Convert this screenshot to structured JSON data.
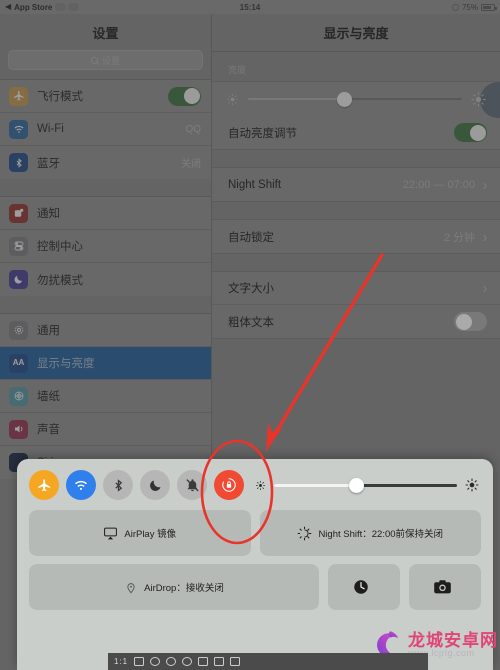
{
  "statusbar": {
    "back_icon": "back-arrow-icon",
    "app_name": "App Store",
    "time": "15:14",
    "battery_percent": "75%"
  },
  "sidebar": {
    "title": "设置",
    "search": {
      "placeholder": "设置",
      "icon": "search-icon"
    },
    "groups": [
      {
        "items": [
          {
            "label": "飞行模式",
            "icon": "airplane-icon",
            "color": "#f5a623",
            "control": "toggle",
            "on": true
          },
          {
            "label": "Wi-Fi",
            "icon": "wifi-icon",
            "color": "#1b7fe0",
            "control": "value",
            "value": "QQ"
          },
          {
            "label": "蓝牙",
            "icon": "bluetooth-icon",
            "color": "#1b5fd0",
            "control": "value",
            "value": "关闭"
          }
        ]
      },
      {
        "items": [
          {
            "label": "通知",
            "icon": "notification-icon",
            "color": "#e0342b",
            "control": "none"
          },
          {
            "label": "控制中心",
            "icon": "control-center-icon",
            "color": "#8e8e93",
            "control": "none"
          },
          {
            "label": "勿扰模式",
            "icon": "moon-icon",
            "color": "#5b4ce0",
            "control": "none"
          }
        ]
      },
      {
        "items": [
          {
            "label": "通用",
            "icon": "gear-icon",
            "color": "#8e8e93",
            "control": "none"
          },
          {
            "label": "显示与亮度",
            "icon": "display-aa-icon",
            "color": "#1b5fd0",
            "control": "none",
            "selected": true
          },
          {
            "label": "墙纸",
            "icon": "wallpaper-icon",
            "color": "#3fb0c9",
            "control": "none"
          },
          {
            "label": "声音",
            "icon": "sound-icon",
            "color": "#e0346b",
            "control": "none"
          },
          {
            "label": "Siri",
            "icon": "siri-icon",
            "color": "#2a3a6e",
            "control": "none"
          }
        ]
      }
    ]
  },
  "detail": {
    "title": "显示与亮度",
    "brightness_header": "亮度",
    "brightness_percent": 45,
    "brightness_low_icon": "sun-low-icon",
    "brightness_high_icon": "sun-high-icon",
    "rows_group1": [
      {
        "label": "自动亮度调节",
        "control": "toggle",
        "on": true
      }
    ],
    "rows_group2": [
      {
        "label": "Night Shift",
        "value": "22:00 — 07:00",
        "control": "chevron"
      }
    ],
    "rows_group3": [
      {
        "label": "自动锁定",
        "value": "2 分钟",
        "control": "chevron"
      }
    ],
    "rows_group4": [
      {
        "label": "文字大小",
        "value": "",
        "control": "chevron"
      },
      {
        "label": "粗体文本",
        "control": "toggle",
        "on": false
      }
    ]
  },
  "control_center": {
    "toggles": [
      {
        "name": "airplane-mode-toggle",
        "icon": "airplane-icon",
        "color": "#f5a623",
        "active": true
      },
      {
        "name": "wifi-toggle",
        "icon": "wifi-icon",
        "color": "#1b7fe0",
        "active": true
      },
      {
        "name": "bluetooth-toggle",
        "icon": "bluetooth-icon",
        "color": "#b6b6b6",
        "active": false
      },
      {
        "name": "do-not-disturb-toggle",
        "icon": "moon-icon",
        "color": "#b6b6b6",
        "active": false
      },
      {
        "name": "mute-toggle",
        "icon": "bell-slash-icon",
        "color": "#b6b6b6",
        "active": false
      },
      {
        "name": "rotation-lock-toggle",
        "icon": "rotation-lock-icon",
        "color": "#f04a33",
        "active": true
      }
    ],
    "brightness_percent": 45,
    "brightness_low_icon": "sun-low-icon",
    "brightness_high_icon": "sun-high-icon",
    "tiles_row1": [
      {
        "label": "AirPlay 镜像",
        "icon": "airplay-icon"
      },
      {
        "label": "Night Shift：22:00前保持关闭",
        "icon": "night-shift-icon"
      }
    ],
    "tiles_row2": [
      {
        "label": "AirDrop：接收关闭",
        "icon": "airdrop-icon"
      },
      {
        "label": "",
        "icon": "timer-icon"
      },
      {
        "label": "",
        "icon": "camera-icon"
      }
    ]
  },
  "annotation": {
    "arrow_color": "#e8342a",
    "ellipse_color": "#e8342a",
    "target": "rotation-lock-toggle"
  },
  "watermark": {
    "site_name": "龙城安卓网",
    "url": "www.lcjrlg.com"
  },
  "dock": {
    "label": "1:1"
  }
}
